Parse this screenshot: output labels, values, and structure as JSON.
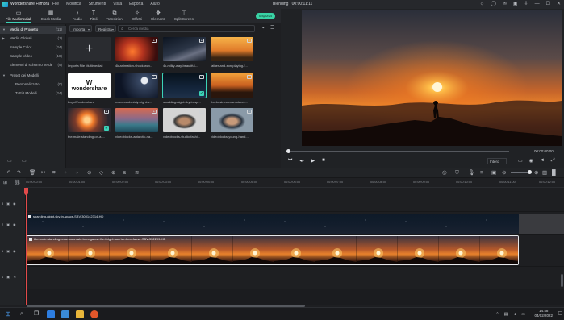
{
  "titlebar": {
    "app_name": "Wondershare Filmora",
    "menu": [
      "File",
      "Modifica",
      "Strumenti",
      "Vista",
      "Esporta",
      "Aiuto"
    ],
    "document": "Blending : 00:00:11:11"
  },
  "toolbar": {
    "tabs": [
      "File Multimediali",
      "Stock Media",
      "Audio",
      "Titoli",
      "Transizioni",
      "Effetti",
      "Elementi",
      "Split Screen"
    ],
    "export_label": "Esporta"
  },
  "sidebar": {
    "items": [
      {
        "label": "Media di Progetto",
        "count": "(11)"
      },
      {
        "label": "Media Globali",
        "count": "(1)"
      },
      {
        "label": "Sample Color",
        "count": "(24)"
      },
      {
        "label": "Sample Video",
        "count": "(18)"
      },
      {
        "label": "Elementi di schermo verde",
        "count": "(9)"
      },
      {
        "label": "Preset dei Modelli",
        "count": ""
      },
      {
        "label": "Personalizzato",
        "count": "(0)"
      },
      {
        "label": "Tutti I Modelli",
        "count": "(24)"
      }
    ]
  },
  "media": {
    "import_label": "Importa",
    "record_label": "Registra",
    "search_placeholder": "Cerca media",
    "items": [
      {
        "name": "Importa File Multimediali"
      },
      {
        "name": "4k-animation-shock-wav..."
      },
      {
        "name": "4k-milky-way-beautiful-..."
      },
      {
        "name": "father-and-son-playing-f..."
      },
      {
        "name": "LogoWondershare"
      },
      {
        "name": "moon-and-misty-night-s..."
      },
      {
        "name": "sparkling-night-sky-in-sp..."
      },
      {
        "name": "the-businessman-stand-..."
      },
      {
        "name": "the-male-standing-on-a-..."
      },
      {
        "name": "videoblocks-antarctic-na..."
      },
      {
        "name": "videoblocks-studio-fashi..."
      },
      {
        "name": "videoblocks-young-hand..."
      }
    ],
    "wondershare_logo_text": "wondershare"
  },
  "preview": {
    "timecode": "00:00:00:00",
    "quality": "Intero"
  },
  "timeline": {
    "ruler": [
      "00:00:00:00",
      "00:00:01:00",
      "00:00:02:00",
      "00:00:03:00",
      "00:00:04:00",
      "00:00:05:00",
      "00:00:06:00",
      "00:00:07:00",
      "00:00:08:00",
      "00:00:09:00",
      "00:00:10:00",
      "00:00:11:00",
      "00:00:12:00"
    ],
    "tracks": [
      "3",
      "2",
      "1",
      "1"
    ],
    "clip_space_title": "sparkling-night-sky-in-space-SBV-300142314-HD",
    "clip_sunset_title": "the-male-standing-on-a-mountain-top-against-the-bright-sunrise-time-lapse-SBV-332209-HD"
  },
  "taskbar": {
    "time": "14:48",
    "date": "04/02/2022"
  },
  "colors": {
    "accent": "#3cd3b8",
    "export": "#39d3a5",
    "playhead": "#e24a4a"
  }
}
